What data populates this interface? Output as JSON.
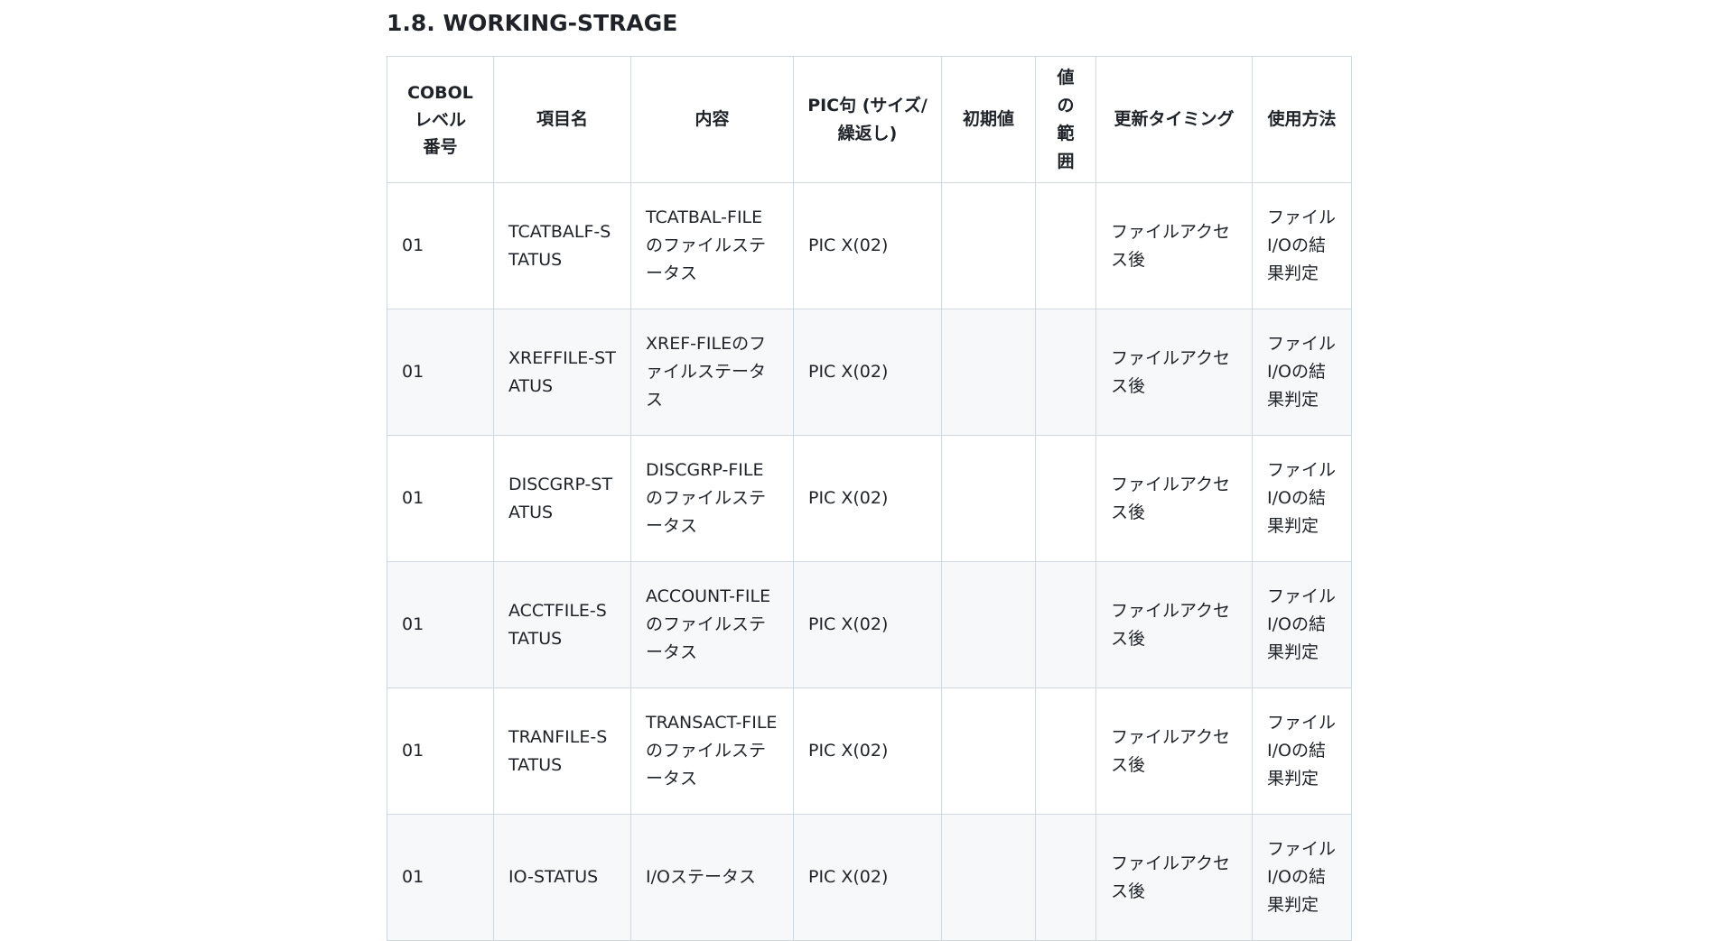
{
  "section": {
    "title": "1.8. WORKING-STRAGE"
  },
  "table": {
    "headers": [
      "COBOL\nレベル\n番号",
      "項目名",
      "内容",
      "PIC句 (サイズ/繰返し)",
      "初期値",
      "値\nの\n範\n囲",
      "更新タイミング",
      "使用方法"
    ],
    "rows": [
      {
        "level": "01",
        "name": "TCATBALF-STATUS",
        "content": "TCATBAL-FILEのファイルステータス",
        "pic": "PIC X(02)",
        "initial": "",
        "range": "",
        "timing": "ファイルアクセス後",
        "usage": "ファイルI/Oの結果判定"
      },
      {
        "level": "01",
        "name": "XREFFILE-STATUS",
        "content": "XREF-FILEのファイルステータス",
        "pic": "PIC X(02)",
        "initial": "",
        "range": "",
        "timing": "ファイルアクセス後",
        "usage": "ファイルI/Oの結果判定"
      },
      {
        "level": "01",
        "name": "DISCGRP-STATUS",
        "content": "DISCGRP-FILEのファイルステータス",
        "pic": "PIC X(02)",
        "initial": "",
        "range": "",
        "timing": "ファイルアクセス後",
        "usage": "ファイルI/Oの結果判定"
      },
      {
        "level": "01",
        "name": "ACCTFILE-STATUS",
        "content": "ACCOUNT-FILEのファイルステータス",
        "pic": "PIC X(02)",
        "initial": "",
        "range": "",
        "timing": "ファイルアクセス後",
        "usage": "ファイルI/Oの結果判定"
      },
      {
        "level": "01",
        "name": "TRANFILE-STATUS",
        "content": "TRANSACT-FILEのファイルステータス",
        "pic": "PIC X(02)",
        "initial": "",
        "range": "",
        "timing": "ファイルアクセス後",
        "usage": "ファイルI/Oの結果判定"
      },
      {
        "level": "01",
        "name": "IO-STATUS",
        "content": "I/Oステータス",
        "pic": "PIC X(02)",
        "initial": "",
        "range": "",
        "timing": "ファイルアクセス後",
        "usage": "ファイルI/Oの結果判定"
      }
    ]
  }
}
